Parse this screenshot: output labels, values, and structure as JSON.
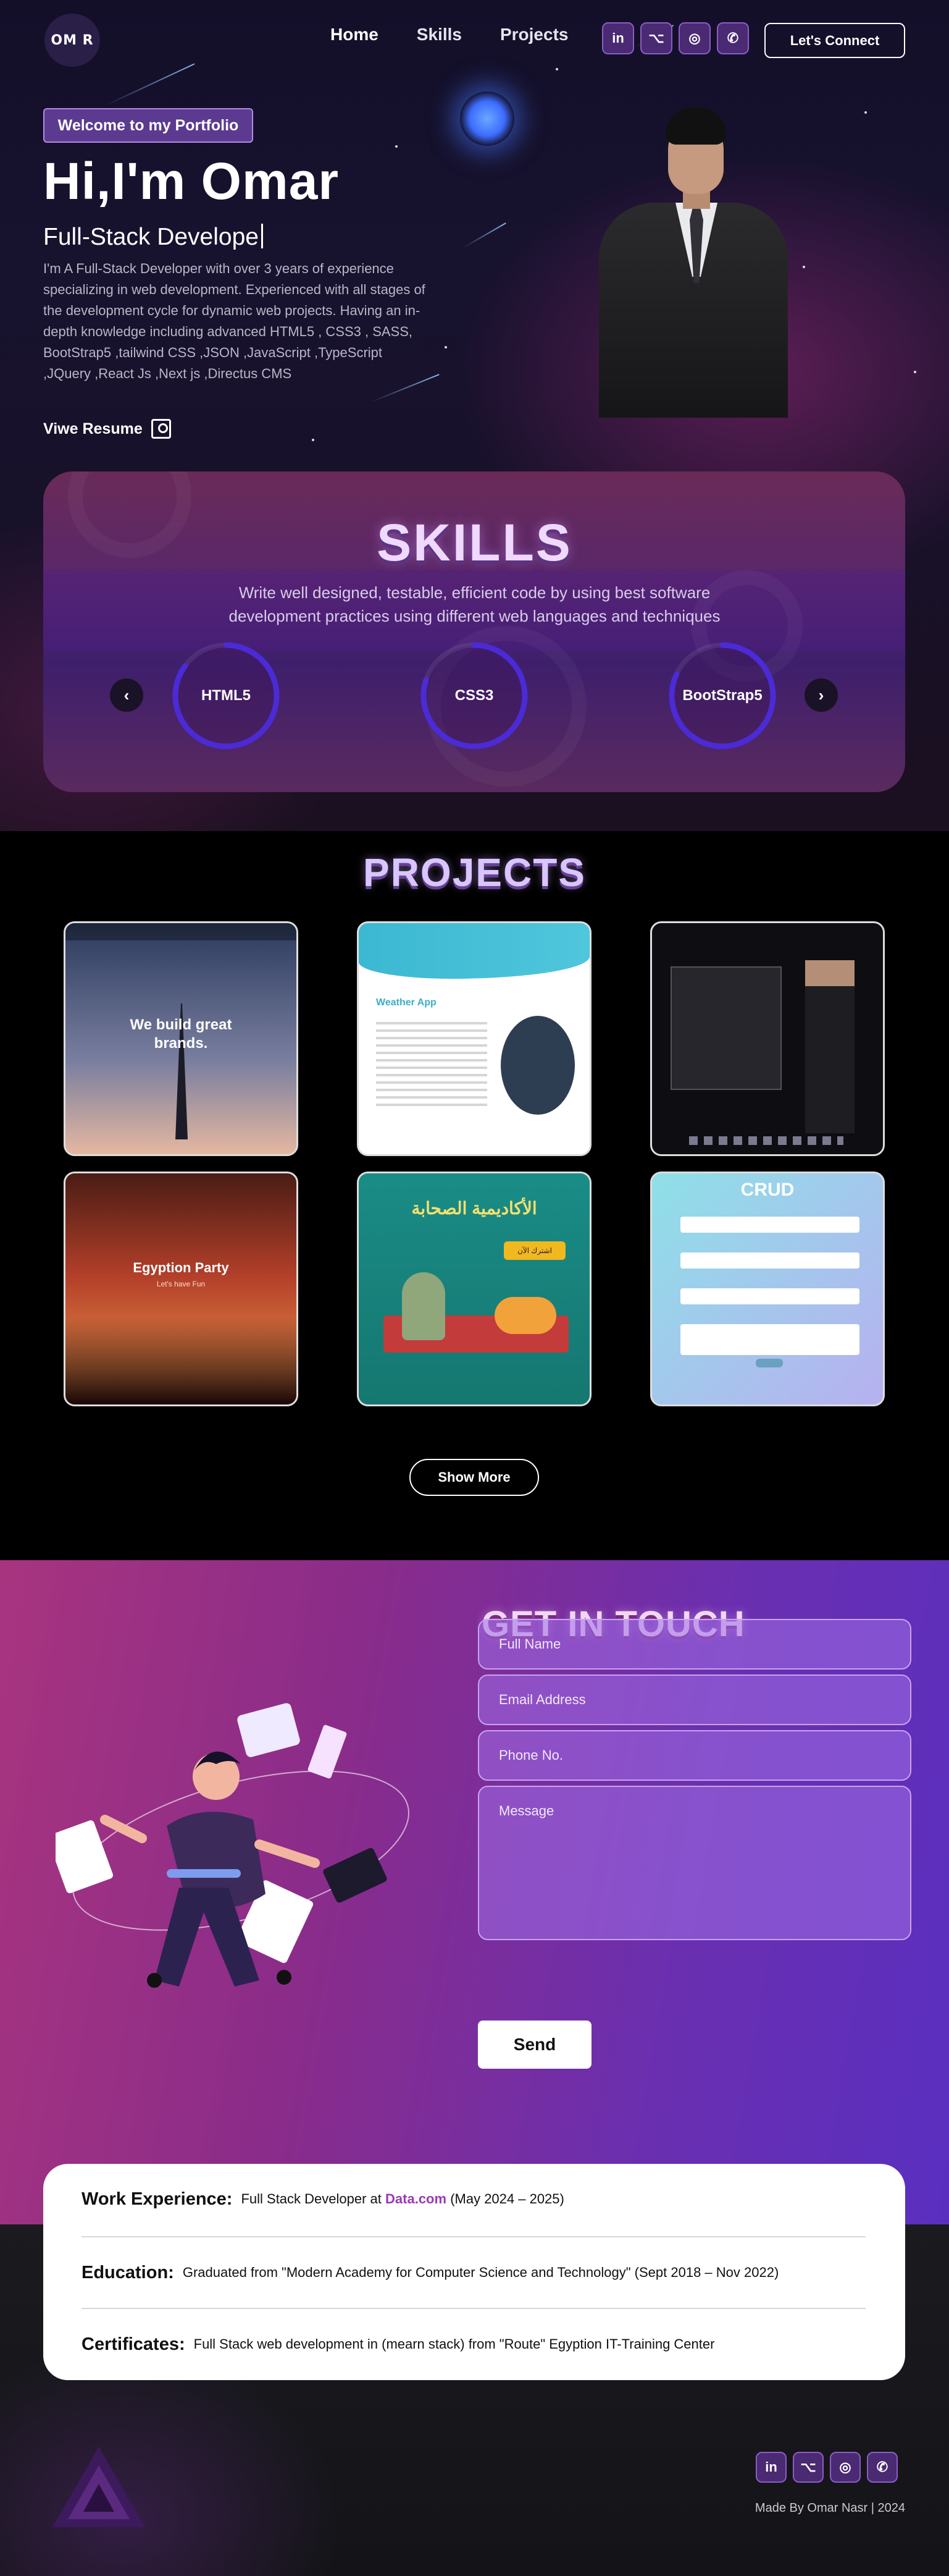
{
  "brand": {
    "logo_text": "OM R"
  },
  "nav": {
    "items": [
      "Home",
      "Skills",
      "Projects"
    ]
  },
  "social": {
    "icons": [
      "in",
      "⌥",
      "◎",
      "✆"
    ],
    "names": [
      "linkedin-icon",
      "github-icon",
      "instagram-icon",
      "whatsapp-icon"
    ]
  },
  "header": {
    "cta_label": "Let's Connect"
  },
  "hero": {
    "badge": "Welcome to my Portfolio",
    "title": "Hi,I'm Omar",
    "subtitle": "Full-Stack Develope",
    "description": "I'm A Full-Stack Developer with over 3 years of experience specializing in web development. Experienced with all stages of the development cycle for dynamic web projects. Having an in-depth knowledge including advanced HTML5 , CSS3 , SASS, BootStrap5 ,tailwind CSS ,JSON ,JavaScript ,TypeScript ,JQuery ,React Js ,Next js ,Directus CMS",
    "resume_label": "Viwe Resume"
  },
  "skills": {
    "title": "SKILLS",
    "description_line1": "Write well designed, testable, efficient code by using best software",
    "description_line2": "development practices using different web languages and techniques",
    "items": [
      {
        "label": "HTML5",
        "progress": 0.85
      },
      {
        "label": "CSS3",
        "progress": 0.8
      },
      {
        "label": "BootStrap5",
        "progress": 0.82
      }
    ],
    "prev_icon": "‹",
    "next_icon": "›"
  },
  "projects": {
    "title": "PROJECTS",
    "cards": [
      {
        "heading": "We build great brands.",
        "small": ""
      },
      {
        "heading": "Weather App",
        "small": ""
      },
      {
        "heading": "",
        "small": ""
      },
      {
        "heading": "Egyption Party",
        "small": "Let's have Fun"
      },
      {
        "heading": "الأكاديمية الصحابة",
        "small": "اشترك الآن"
      },
      {
        "heading": "CRUD",
        "small": ""
      }
    ],
    "show_more_label": "Show More"
  },
  "contact": {
    "title": "GET IN TOUCH",
    "placeholders": {
      "name": "Full Name",
      "email": "Email Address",
      "phone": "Phone No.",
      "message": "Message"
    },
    "send_label": "Send"
  },
  "info": {
    "work_label": "Work Experience:",
    "work_text_pre": "Full Stack Developer at",
    "work_company": "Data.com",
    "work_text_post": "(May 2024 – 2025)",
    "edu_label": "Education:",
    "edu_text": "Graduated from \"Modern Academy for Computer Science and Technology\" (Sept 2018 – Nov 2022)",
    "cert_label": "Certificates:",
    "cert_text": "Full Stack web development in (mearn stack) from \"Route\" Egyption IT-Training Center"
  },
  "footer": {
    "credit": "Made By Omar Nasr | 2024"
  },
  "colors": {
    "accent": "#9b3ab5",
    "ring": "#4b2bd6",
    "badge": "#5b3a8f"
  }
}
